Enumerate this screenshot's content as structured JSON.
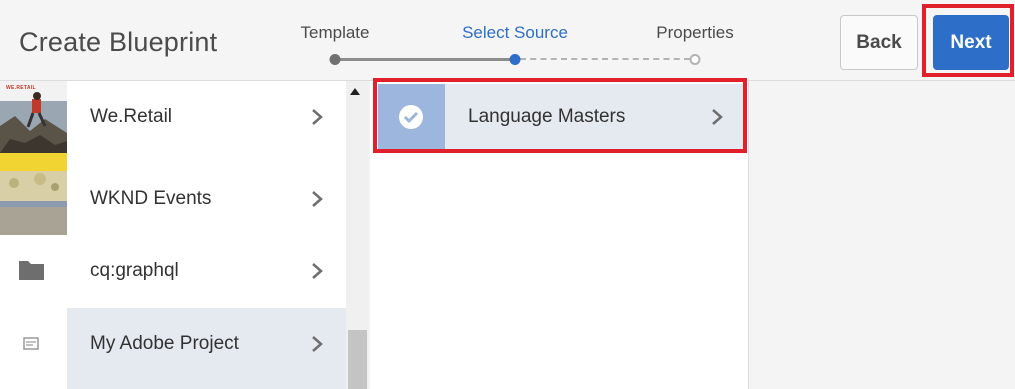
{
  "header": {
    "title": "Create Blueprint",
    "back_label": "Back",
    "next_label": "Next"
  },
  "wizard": {
    "steps": [
      {
        "label": "Template",
        "state": "done"
      },
      {
        "label": "Select Source",
        "state": "active"
      },
      {
        "label": "Properties",
        "state": "todo"
      }
    ]
  },
  "column1": {
    "items": [
      {
        "label": "We.Retail",
        "thumb": "photo-climber",
        "logo_text": "WE.RETAIL"
      },
      {
        "label": "WKND Events",
        "thumb": "photo-landscape"
      },
      {
        "label": "cq:graphql",
        "thumb": "folder-icon"
      },
      {
        "label": "My Adobe Project",
        "thumb": "page-icon",
        "selected": true
      }
    ]
  },
  "column2": {
    "items": [
      {
        "label": "Language Masters",
        "selected": true
      }
    ]
  },
  "colors": {
    "accent": "#2d6ec9",
    "highlight": "#e0202a",
    "selected_row": "#e5eaf1"
  }
}
